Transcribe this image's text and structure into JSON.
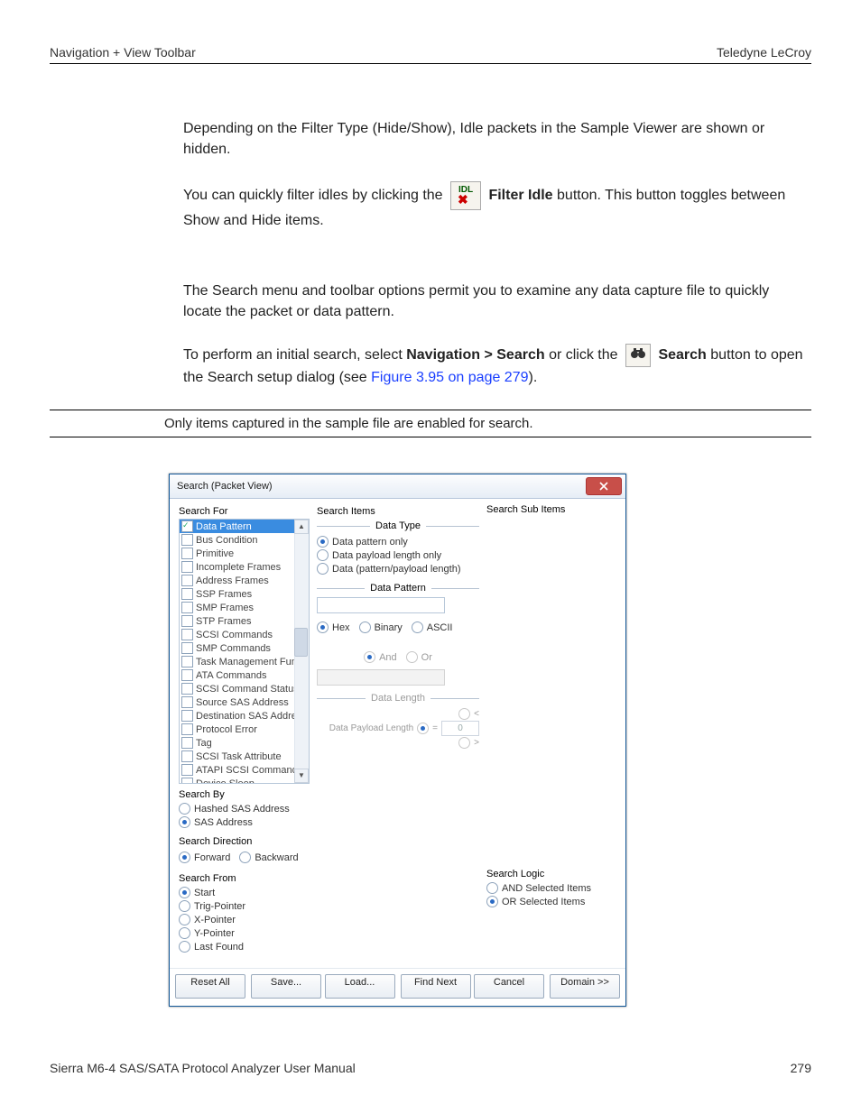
{
  "header": {
    "left": "Navigation + View Toolbar",
    "right": "Teledyne LeCroy"
  },
  "body": {
    "p1": "Depending on the Filter Type (Hide/Show), Idle packets in the Sample Viewer are shown or hidden.",
    "p2a": "You can quickly filter idles by clicking the ",
    "p2b_bold": "Filter Idle",
    "p2c": " button. This button toggles between Show and Hide items.",
    "p3": "The Search menu and toolbar options permit you to examine any data capture file to quickly locate the packet or data pattern.",
    "p4a": "To perform an initial search, select ",
    "p4b_bold": "Navigation > Search",
    "p4c": " or click the ",
    "p4d_bold": "Search",
    "p4e": " button to open the Search setup dialog (see ",
    "p4_link": "Figure 3.95 on page 279",
    "p4f": ").",
    "note": "Only items captured in the sample file are enabled for search."
  },
  "icons": {
    "idl_label": "IDL",
    "binoculars": "👁"
  },
  "dialog": {
    "title": "Search (Packet View)",
    "col1": {
      "search_for": "Search For",
      "items": [
        {
          "label": "Data Pattern",
          "checked": true,
          "selected": true
        },
        {
          "label": "Bus Condition"
        },
        {
          "label": "Primitive"
        },
        {
          "label": "Incomplete Frames"
        },
        {
          "label": "Address Frames"
        },
        {
          "label": "SSP Frames"
        },
        {
          "label": "SMP Frames"
        },
        {
          "label": "STP Frames"
        },
        {
          "label": "SCSI Commands"
        },
        {
          "label": "SMP Commands"
        },
        {
          "label": "Task Management Func"
        },
        {
          "label": "ATA Commands"
        },
        {
          "label": "SCSI Command Status"
        },
        {
          "label": "Source SAS Address"
        },
        {
          "label": "Destination SAS Address"
        },
        {
          "label": "Protocol Error"
        },
        {
          "label": "Tag"
        },
        {
          "label": "SCSI Task Attribute"
        },
        {
          "label": "ATAPI SCSI Command"
        },
        {
          "label": "Device Sleep"
        }
      ],
      "search_by": "Search By",
      "by_hashed": "Hashed SAS Address",
      "by_sas": "SAS Address",
      "search_dir": "Search Direction",
      "dir_fwd": "Forward",
      "dir_bwd": "Backward",
      "search_from": "Search From",
      "from_start": "Start",
      "from_trig": "Trig-Pointer",
      "from_x": "X-Pointer",
      "from_y": "Y-Pointer",
      "from_last": "Last Found"
    },
    "col2": {
      "search_items": "Search Items",
      "data_type": "Data Type",
      "dt_pattern": "Data pattern only",
      "dt_payload": "Data payload length only",
      "dt_both": "Data (pattern/payload length)",
      "data_pattern": "Data Pattern",
      "fmt_hex": "Hex",
      "fmt_bin": "Binary",
      "fmt_ascii": "ASCII",
      "op_and": "And",
      "op_or": "Or",
      "data_length": "Data Length",
      "cmp_lt": "<",
      "cmp_eq": "=",
      "cmp_gt": ">",
      "dpl_label": "Data Payload Length",
      "dpl_val": "0"
    },
    "col3": {
      "search_sub": "Search Sub Items",
      "search_logic": "Search Logic",
      "and_sel": "AND Selected Items",
      "or_sel": "OR Selected Items"
    },
    "buttons": {
      "reset": "Reset All",
      "save": "Save...",
      "load": "Load...",
      "find": "Find Next",
      "cancel": "Cancel",
      "domain": "Domain >>"
    }
  },
  "footer": {
    "left": "Sierra M6-4 SAS/SATA Protocol Analyzer User Manual",
    "right": "279"
  }
}
